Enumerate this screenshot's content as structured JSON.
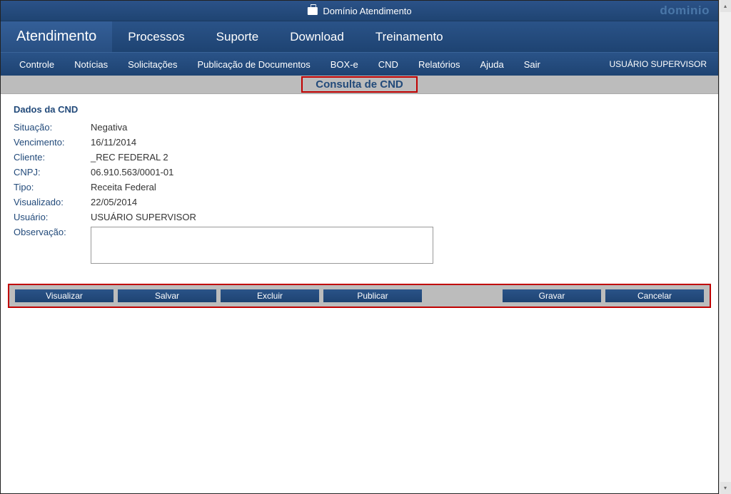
{
  "header": {
    "app_title": "Domínio Atendimento",
    "logo_text": "dominio"
  },
  "main_nav": {
    "items": [
      {
        "label": "Atendimento",
        "active": true
      },
      {
        "label": "Processos"
      },
      {
        "label": "Suporte"
      },
      {
        "label": "Download"
      },
      {
        "label": "Treinamento"
      }
    ]
  },
  "sub_nav": {
    "items": [
      {
        "label": "Controle"
      },
      {
        "label": "Notícias"
      },
      {
        "label": "Solicitações"
      },
      {
        "label": "Publicação de Documentos"
      },
      {
        "label": "BOX-e"
      },
      {
        "label": "CND"
      },
      {
        "label": "Relatórios"
      },
      {
        "label": "Ajuda"
      },
      {
        "label": "Sair"
      }
    ],
    "user_label": "USUÁRIO SUPERVISOR"
  },
  "page_title": "Consulta de CND",
  "section": {
    "title": "Dados da CND",
    "fields": {
      "situacao": {
        "label": "Situação:",
        "value": "Negativa"
      },
      "vencimento": {
        "label": "Vencimento:",
        "value": "16/11/2014"
      },
      "cliente": {
        "label": "Cliente:",
        "value": "_REC FEDERAL 2"
      },
      "cnpj": {
        "label": "CNPJ:",
        "value": "06.910.563/0001-01"
      },
      "tipo": {
        "label": "Tipo:",
        "value": "Receita Federal"
      },
      "visualizado": {
        "label": "Visualizado:",
        "value": "22/05/2014"
      },
      "usuario": {
        "label": "Usuário:",
        "value": "USUÁRIO SUPERVISOR"
      },
      "observacao": {
        "label": "Observação:",
        "value": ""
      }
    }
  },
  "buttons": {
    "visualizar": "Visualizar",
    "salvar": "Salvar",
    "excluir": "Excluir",
    "publicar": "Publicar",
    "gravar": "Gravar",
    "cancelar": "Cancelar"
  }
}
